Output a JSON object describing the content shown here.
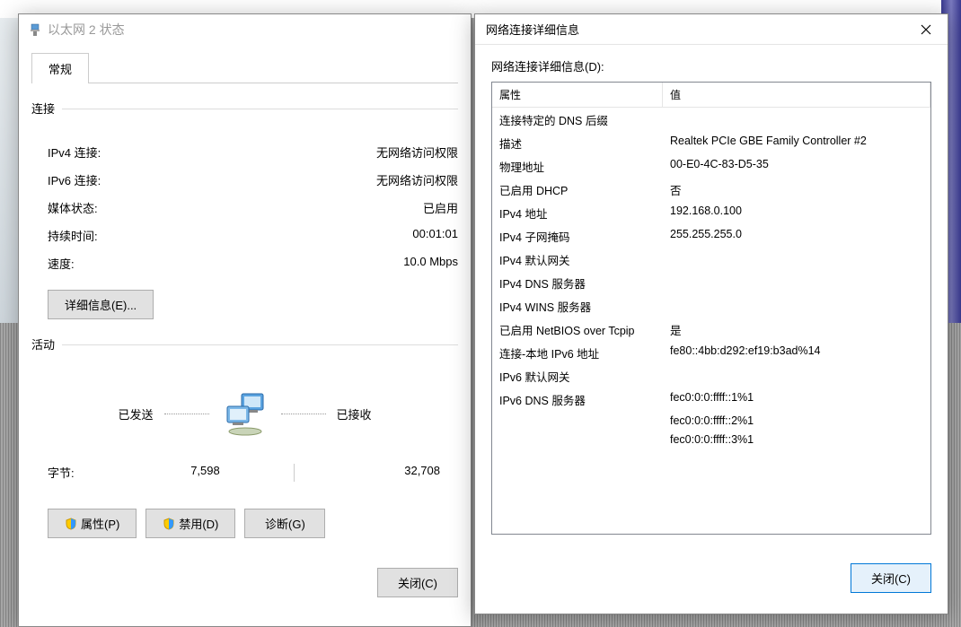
{
  "status_dialog": {
    "title": "以太网 2 状态",
    "tab_general": "常规",
    "section_connection": "连接",
    "ipv4_label": "IPv4 连接:",
    "ipv4_value": "无网络访问权限",
    "ipv6_label": "IPv6 连接:",
    "ipv6_value": "无网络访问权限",
    "media_state_label": "媒体状态:",
    "media_state_value": "已启用",
    "duration_label": "持续时间:",
    "duration_value": "00:01:01",
    "speed_label": "速度:",
    "speed_value": "10.0 Mbps",
    "details_btn": "详细信息(E)...",
    "section_activity": "活动",
    "sent_label": "已发送",
    "received_label": "已接收",
    "bytes_label": "字节:",
    "bytes_sent": "7,598",
    "bytes_received": "32,708",
    "properties_btn": "属性(P)",
    "disable_btn": "禁用(D)",
    "diagnose_btn": "诊断(G)",
    "close_btn": "关闭(C)"
  },
  "details_dialog": {
    "title": "网络连接详细信息",
    "heading": "网络连接详细信息(D):",
    "col_property": "属性",
    "col_value": "值",
    "rows": [
      {
        "prop": "连接特定的 DNS 后缀",
        "val": ""
      },
      {
        "prop": "描述",
        "val": "Realtek PCIe GBE Family Controller #2"
      },
      {
        "prop": "物理地址",
        "val": "00-E0-4C-83-D5-35"
      },
      {
        "prop": "已启用 DHCP",
        "val": "否"
      },
      {
        "prop": "IPv4 地址",
        "val": "192.168.0.100"
      },
      {
        "prop": "IPv4 子网掩码",
        "val": "255.255.255.0"
      },
      {
        "prop": "IPv4 默认网关",
        "val": ""
      },
      {
        "prop": "IPv4 DNS 服务器",
        "val": ""
      },
      {
        "prop": "IPv4 WINS 服务器",
        "val": ""
      },
      {
        "prop": "已启用 NetBIOS over Tcpip",
        "val": "是"
      },
      {
        "prop": "连接-本地 IPv6 地址",
        "val": "fe80::4bb:d292:ef19:b3ad%14"
      },
      {
        "prop": "IPv6 默认网关",
        "val": ""
      },
      {
        "prop": "IPv6 DNS 服务器",
        "val": "fec0:0:0:ffff::1%1"
      },
      {
        "prop": "",
        "val": "fec0:0:0:ffff::2%1"
      },
      {
        "prop": "",
        "val": "fec0:0:0:ffff::3%1"
      }
    ],
    "close_btn": "关闭(C)"
  }
}
